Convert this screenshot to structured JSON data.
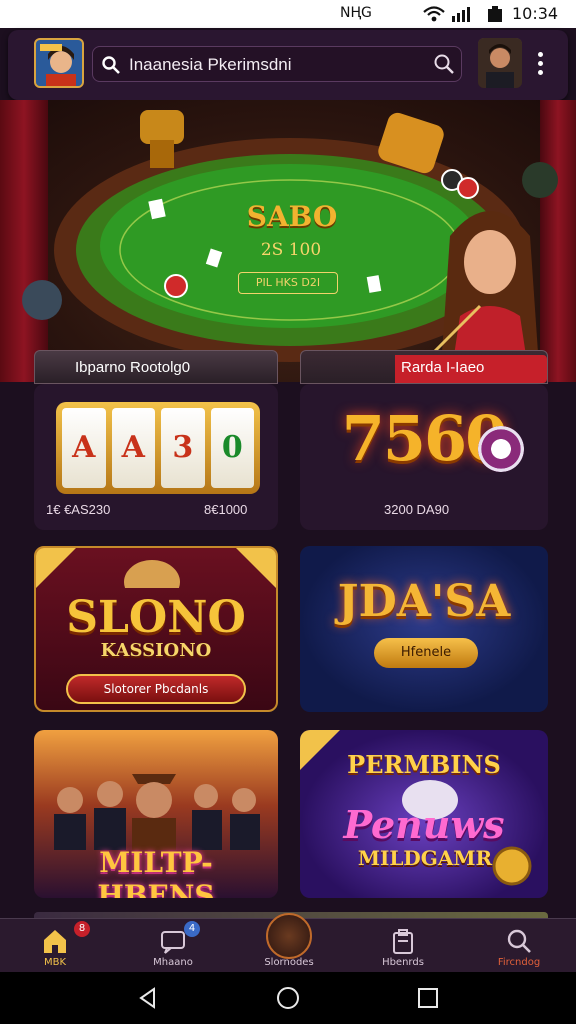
{
  "status_bar": {
    "network": "NⱧG",
    "time": "10:34",
    "icons": [
      "wifi-icon",
      "signal-icon",
      "battery-icon"
    ]
  },
  "header": {
    "search_text": "Inaanesia Pkerimsdni",
    "icons": [
      "search-icon",
      "search-icon",
      "more-vertical-icon"
    ]
  },
  "hero": {
    "title": "SABO",
    "amount": "2S 100",
    "subtitle": "PIL HKS D2I"
  },
  "promo_tabs": [
    {
      "label": "Ibparno Rootolg0"
    },
    {
      "label": "Rarda I-Iaeo"
    }
  ],
  "games": [
    {
      "id": "slots",
      "reels": [
        "A",
        "A",
        "3",
        "0"
      ],
      "caption_left": "1€ €AS230",
      "caption_right": "8€1000"
    },
    {
      "id": "sevens",
      "big_text": "7560",
      "caption": "3200 DA90"
    },
    {
      "id": "kassiono",
      "logo_top": "SLONO",
      "logo_bottom": "KASSIONO",
      "cta": "Slotorer Pbcdanls"
    },
    {
      "id": "joasa",
      "logo_top": "JDA'SA",
      "cta": "Hfenele"
    },
    {
      "id": "miltp",
      "logo_top": "MILTP-HBENS"
    },
    {
      "id": "permbins",
      "logo_top": "PERMBINS",
      "logo_mid": "Penuws",
      "logo_bottom": "MILDGAMR"
    }
  ],
  "bottom_nav": [
    {
      "label": "MBK",
      "icon": "home-icon",
      "badge": "8",
      "active": true
    },
    {
      "label": "Mhaano",
      "icon": "chat-icon",
      "badge": "4",
      "active": false
    },
    {
      "label": "Slornodes",
      "icon": "spin-icon",
      "badge": "",
      "active": false
    },
    {
      "label": "Hbenrds",
      "icon": "wallet-icon",
      "badge": "",
      "active": false
    },
    {
      "label": "Fircndog",
      "icon": "search-icon",
      "badge": "",
      "active": false
    }
  ],
  "colors": {
    "accent_gold": "#f2b330",
    "accent_red": "#c6202a",
    "nav_active": "#f2c24a",
    "badge_red": "#c6202a",
    "badge_blue": "#3a6ac6"
  },
  "android_nav": [
    "back-icon",
    "home-circle-icon",
    "recents-icon"
  ]
}
